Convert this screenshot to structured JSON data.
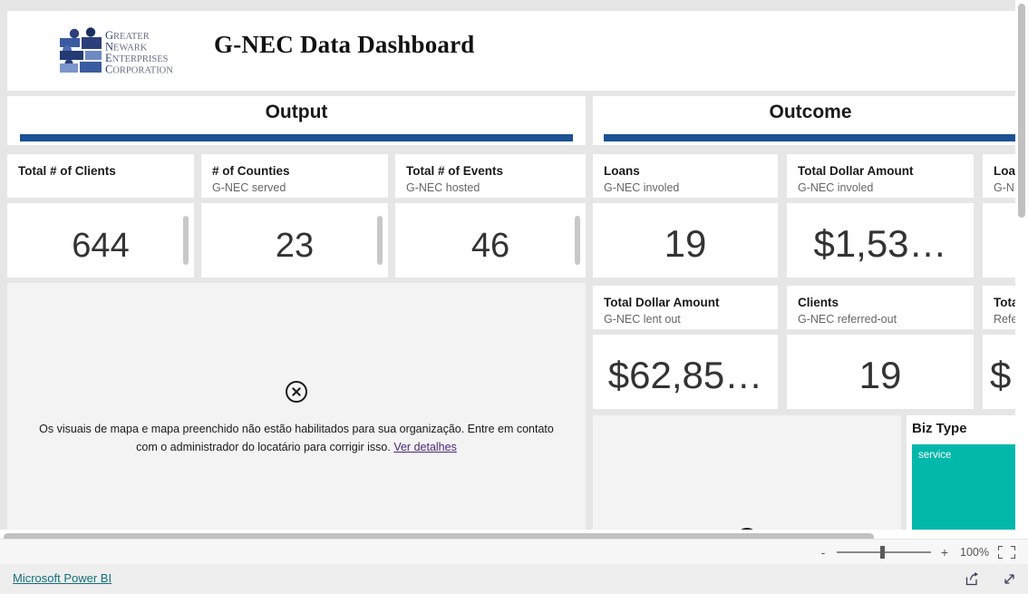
{
  "header": {
    "title": "G-NEC Data Dashboard",
    "logo": {
      "name": "gnec-logo",
      "lines": [
        "GREATER",
        "NEWARK",
        "ENTERPRISES",
        "CORPORATION"
      ]
    }
  },
  "sections": {
    "output": {
      "title": "Output",
      "accent_color": "#1a5293"
    },
    "outcome": {
      "title": "Outcome",
      "accent_color": "#1a5293"
    }
  },
  "output_cards": [
    {
      "title": "Total # of Clients",
      "subtitle": "",
      "value": "644"
    },
    {
      "title": "# of Counties",
      "subtitle": "G-NEC served",
      "value": "23"
    },
    {
      "title": "Total # of Events",
      "subtitle": "G-NEC hosted",
      "value": "46"
    }
  ],
  "outcome_cards_row1": [
    {
      "title": "Loans",
      "subtitle": "G-NEC involed",
      "value": "19"
    },
    {
      "title": "Total Dollar Amount",
      "subtitle": "G-NEC involed",
      "value": "$1,53…"
    },
    {
      "title": "Loan",
      "subtitle": "G-NE",
      "value": ""
    }
  ],
  "outcome_cards_row2": [
    {
      "title": "Total Dollar Amount",
      "subtitle": "G-NEC lent out",
      "value": "$62,85…"
    },
    {
      "title": "Clients",
      "subtitle": "G-NEC referred-out",
      "value": "19"
    },
    {
      "title": "Tota",
      "subtitle": "Referr",
      "value": "$"
    }
  ],
  "map_visual": {
    "icon": "error-circle-x-icon",
    "message": "Os visuais de mapa e mapa preenchido não estão habilitados para sua organização. Entre em contato com o administrador do locatário para corrigir isso.",
    "link_label": "Ver detalhes"
  },
  "biz_type": {
    "title": "Biz Type",
    "tile_label": "service",
    "tile_color": "#01b8aa"
  },
  "status_bar": {
    "zoom_out_label": "-",
    "zoom_in_label": "+",
    "zoom_percent": "100%",
    "fit_icon": "fit-to-page-icon"
  },
  "footer": {
    "powerbi_label": "Microsoft Power BI",
    "share_icon": "share-icon",
    "fullscreen_icon": "fullscreen-expand-icon"
  }
}
